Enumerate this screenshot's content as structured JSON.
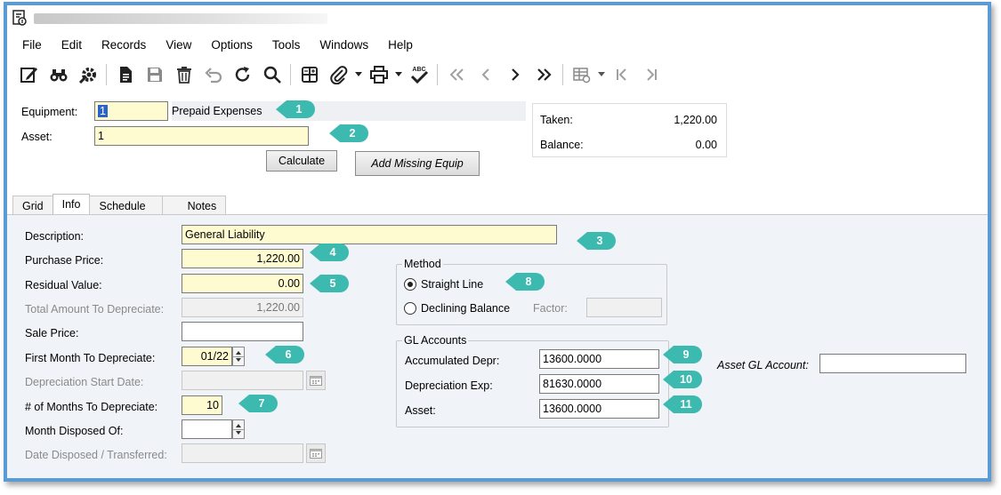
{
  "menu": [
    "File",
    "Edit",
    "Records",
    "View",
    "Options",
    "Tools",
    "Windows",
    "Help"
  ],
  "toolbar": {
    "icons": [
      "edit-icon",
      "binoculars-icon",
      "tools-gear-icon",
      "document-icon",
      "save-icon",
      "trash-icon",
      "undo-icon",
      "refresh-icon",
      "search-icon",
      "calculator-grid-icon",
      "paperclip-icon",
      "print-icon",
      "spellcheck-icon",
      "first-record-icon",
      "previous-record-icon",
      "next-record-icon",
      "last-record-icon",
      "grid-settings-icon",
      "go-first-icon",
      "go-last-icon"
    ],
    "spellcheck_label": "ABC"
  },
  "header": {
    "equipment_label": "Equipment:",
    "equipment_value": "1",
    "equipment_desc": "Prepaid Expenses",
    "asset_label": "Asset:",
    "asset_value": "1",
    "calculate_button": "Calculate",
    "add_missing_button": "Add Missing Equip"
  },
  "summary": {
    "taken_label": "Taken:",
    "taken_value": "1,220.00",
    "balance_label": "Balance:",
    "balance_value": "0.00"
  },
  "tabs": [
    "Grid",
    "Info",
    "Schedule",
    "Notes"
  ],
  "active_tab": "Info",
  "info": {
    "description_label": "Description:",
    "description_value": "General Liability",
    "purchase_price_label": "Purchase Price:",
    "purchase_price_value": "1,220.00",
    "residual_value_label": "Residual Value:",
    "residual_value_value": "0.00",
    "total_depreciate_label": "Total Amount To Depreciate:",
    "total_depreciate_value": "1,220.00",
    "sale_price_label": "Sale Price:",
    "sale_price_value": "",
    "first_month_label": "First Month To Depreciate:",
    "first_month_value": "01/22",
    "dep_start_label": "Depreciation Start Date:",
    "dep_start_value": "",
    "months_label": "# of Months To Depreciate:",
    "months_value": "10",
    "month_disposed_label": "Month Disposed Of:",
    "month_disposed_value": "",
    "date_disposed_label": "Date Disposed / Transferred:",
    "date_disposed_value": ""
  },
  "method": {
    "title": "Method",
    "straight_line": "Straight Line",
    "declining_balance": "Declining Balance",
    "factor_label": "Factor:",
    "factor_value": "",
    "selected": "Straight Line"
  },
  "gl": {
    "title": "GL Accounts",
    "accum_label": "Accumulated Depr:",
    "accum_value": "13600.0000",
    "exp_label": "Depreciation Exp:",
    "exp_value": "81630.0000",
    "asset_label": "Asset:",
    "asset_value": "13600.0000",
    "asset_gl_label": "Asset GL Account:",
    "asset_gl_value": ""
  },
  "callouts": [
    "1",
    "2",
    "3",
    "4",
    "5",
    "6",
    "7",
    "8",
    "9",
    "10",
    "11"
  ],
  "colors": {
    "callout": "#3dbab0",
    "frame": "#5b9bd5",
    "required_field": "#fffbd0"
  }
}
